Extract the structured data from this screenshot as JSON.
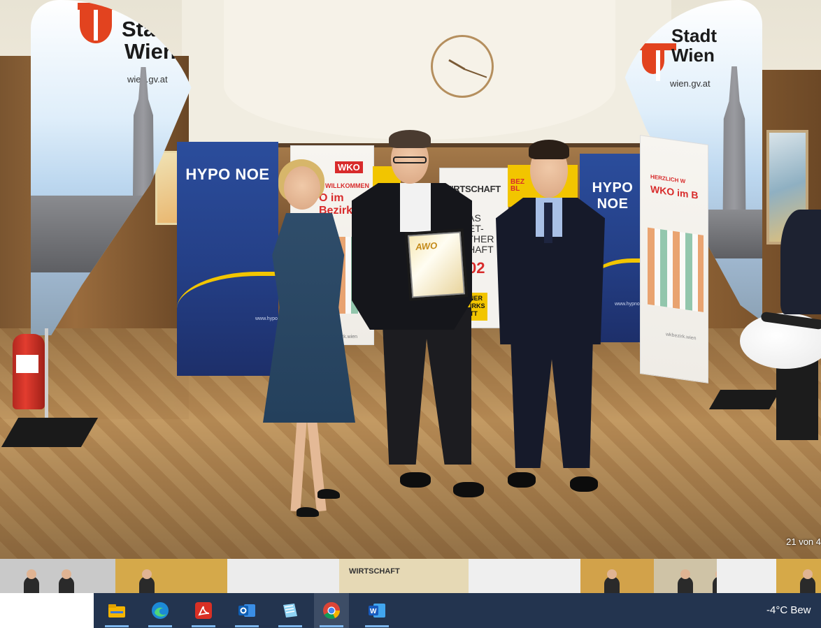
{
  "viewer": {
    "counter": "21 von 4",
    "photo": {
      "flag_left": {
        "name_line1": "Stadt",
        "name_line2": "Wien",
        "url": "wien.gv.at"
      },
      "flag_right": {
        "name_line1": "Stadt",
        "name_line2": "Wien",
        "url": "wien.gv.at"
      },
      "hypo_left": {
        "title": "HYPO NOE",
        "url": "www.hypo"
      },
      "hypo_right": {
        "title": "HYPO NOE",
        "url": "www.hypnoe.at"
      },
      "wko_left": {
        "logo": "WKO",
        "line1": "N WILLKOMMEN",
        "line2": "O im Bezirk",
        "url": "bezirk.wien"
      },
      "wko_right": {
        "line1": "HERZLICH W",
        "line2": "WKO im B",
        "url": "wkbezirk.wien"
      },
      "wirtschaft": {
        "title": "WIRTSCHAFT",
        "slogan_1": "DAS",
        "slogan_2": "GET-",
        "slogan_3": "ETHER",
        "slogan_4": "ER",
        "slogan_5": "CHAFT",
        "number": "02",
        "bb_1": "WIENER",
        "bb_2": "BEZIRKS",
        "bb_3": "BLATT"
      },
      "yellow_right": {
        "line1": "BEZ",
        "line2": "BL"
      },
      "award": {
        "label": "AWO"
      }
    }
  },
  "thumbnails": [
    {
      "label": "",
      "kind": "people",
      "bg": "#c9c9c9"
    },
    {
      "label": "",
      "kind": "person",
      "bg": "#d5a94a"
    },
    {
      "label": "",
      "kind": "blank",
      "bg": "#ececec"
    },
    {
      "label": "WIRTSCHAFT",
      "kind": "banner",
      "bg": "#e6d9b5"
    },
    {
      "label": "",
      "kind": "blank",
      "bg": "#efefef"
    },
    {
      "label": "",
      "kind": "person",
      "bg": "#d2a24a"
    },
    {
      "label": "",
      "kind": "people",
      "bg": "#cfc3a6"
    },
    {
      "label": "",
      "kind": "blank",
      "bg": "#efefef"
    },
    {
      "label": "",
      "kind": "person",
      "bg": "#d6a948"
    }
  ],
  "taskbar": {
    "apps": [
      {
        "name": "file-explorer-icon",
        "active": false
      },
      {
        "name": "edge-icon",
        "active": false
      },
      {
        "name": "acrobat-icon",
        "active": false
      },
      {
        "name": "outlook-icon",
        "active": false
      },
      {
        "name": "notepad-icon",
        "active": false
      },
      {
        "name": "chrome-icon",
        "active": true
      },
      {
        "name": "word-icon",
        "active": false
      }
    ],
    "weather": "-4°C  Bew"
  },
  "colors": {
    "taskbar_bg": "#23344f",
    "accent_red": "#e2431f",
    "hypo_blue": "#2b4d9c",
    "hypo_yellow": "#f2c500"
  }
}
